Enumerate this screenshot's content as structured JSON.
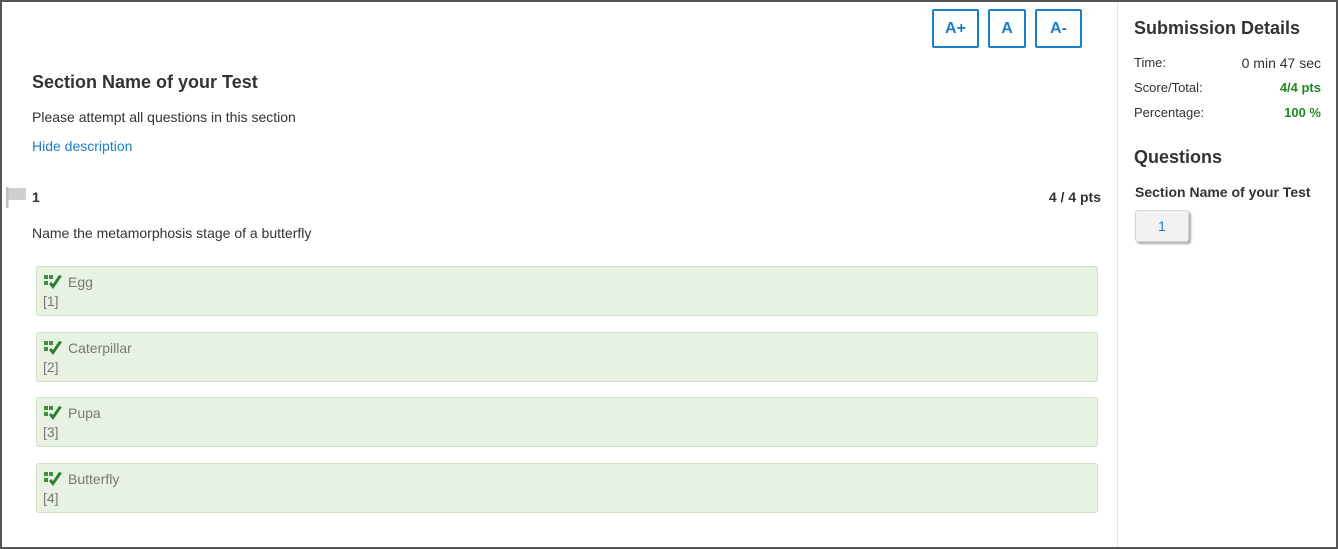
{
  "font_controls": {
    "increase": "A+",
    "normal": "A",
    "decrease": "A-"
  },
  "section": {
    "title": "Section Name of your Test",
    "description": "Please attempt all questions in this section",
    "hide_link": "Hide description"
  },
  "question": {
    "number": "1",
    "points": "4 / 4 pts",
    "text": "Name the metamorphosis stage of a butterfly",
    "answers": [
      {
        "text": "Egg",
        "index": "[1]"
      },
      {
        "text": "Caterpillar",
        "index": "[2]"
      },
      {
        "text": "Pupa",
        "index": "[3]"
      },
      {
        "text": "Butterfly",
        "index": "[4]"
      }
    ]
  },
  "submission": {
    "title": "Submission Details",
    "time_label": "Time:",
    "time_value": "0 min 47 sec",
    "score_label": "Score/Total:",
    "score_value": "4/4 pts",
    "percentage_label": "Percentage:",
    "percentage_value": "100 %"
  },
  "questions_nav": {
    "title": "Questions",
    "section_name": "Section Name of your Test",
    "items": [
      "1"
    ]
  },
  "icons": {
    "flag": "flag-icon",
    "check": "correct-check-icon"
  },
  "colors": {
    "accent": "#1a7fc9",
    "correct_bg": "#e8f2e3",
    "correct_green": "#1e8a1e"
  }
}
